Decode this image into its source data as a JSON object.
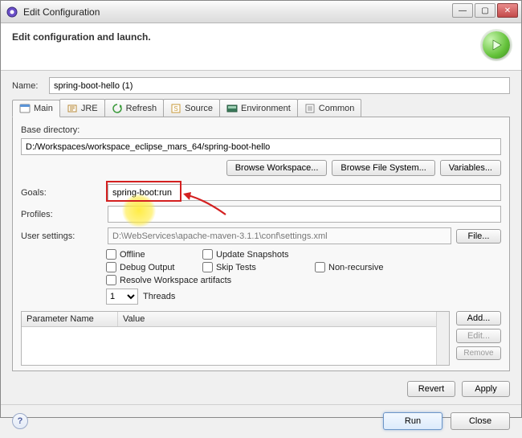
{
  "window": {
    "title": "Edit Configuration"
  },
  "header": {
    "subtitle": "Edit configuration and launch."
  },
  "name_row": {
    "label": "Name:",
    "value": "spring-boot-hello (1)"
  },
  "tabs": [
    {
      "label": "Main"
    },
    {
      "label": "JRE"
    },
    {
      "label": "Refresh"
    },
    {
      "label": "Source"
    },
    {
      "label": "Environment"
    },
    {
      "label": "Common"
    }
  ],
  "baseDirectory": {
    "label": "Base directory:",
    "value": "D:/Workspaces/workspace_eclipse_mars_64/spring-boot-hello"
  },
  "buttons": {
    "browseWorkspace": "Browse Workspace...",
    "browseFileSystem": "Browse File System...",
    "variables": "Variables...",
    "file": "File...",
    "add": "Add...",
    "edit": "Edit...",
    "remove": "Remove",
    "revert": "Revert",
    "apply": "Apply",
    "run": "Run",
    "close": "Close"
  },
  "fields": {
    "goalsLabel": "Goals:",
    "goalsValue": "spring-boot:run",
    "profilesLabel": "Profiles:",
    "profilesValue": "",
    "userSettingsLabel": "User settings:",
    "userSettingsValue": "D:\\WebServices\\apache-maven-3.1.1\\conf\\settings.xml"
  },
  "checks": {
    "offline": "Offline",
    "updateSnapshots": "Update Snapshots",
    "debugOutput": "Debug Output",
    "skipTests": "Skip Tests",
    "nonRecursive": "Non-recursive",
    "resolveWs": "Resolve Workspace artifacts"
  },
  "threads": {
    "value": "1",
    "label": "Threads"
  },
  "paramTable": {
    "colName": "Parameter Name",
    "colValue": "Value"
  }
}
